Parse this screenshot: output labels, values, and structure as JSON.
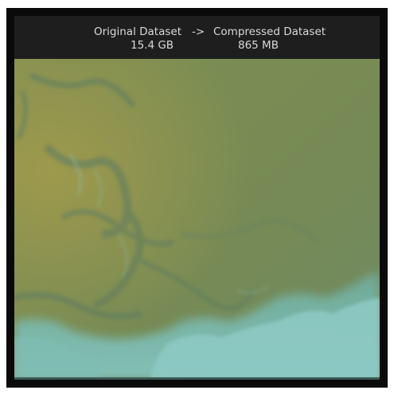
{
  "header": {
    "original_label": "Original Dataset",
    "arrow": "->",
    "compressed_label": "Compressed Dataset",
    "original_size": "15.4 GB",
    "compressed_size": "865 MB"
  },
  "imagery": {
    "base_color": "#7a8a52",
    "left_tint_color": "#9a9a4e",
    "cloud_color": "#7cc0b8",
    "edge_color": "#5a8a80"
  }
}
